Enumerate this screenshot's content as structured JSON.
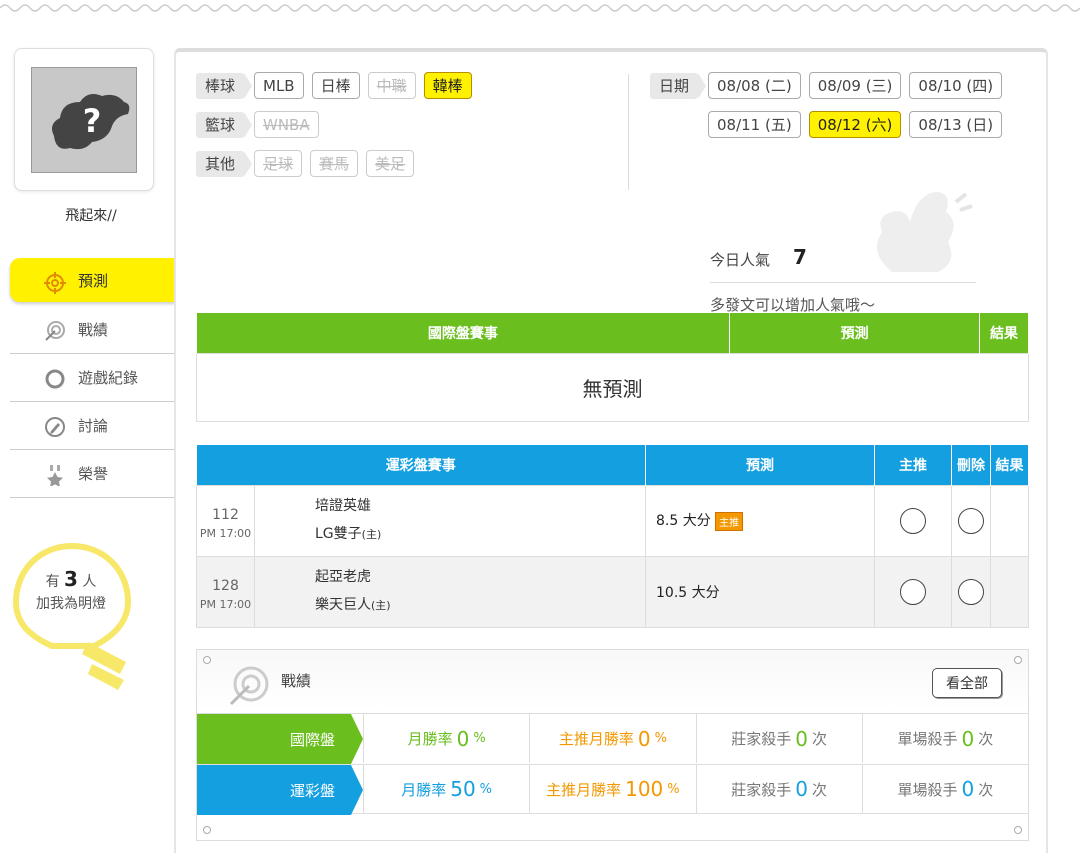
{
  "profile": {
    "username": "飛起來//"
  },
  "nav": {
    "items": [
      {
        "label": "預測",
        "icon": "target-icon",
        "active": true
      },
      {
        "label": "戰績",
        "icon": "record-target-icon"
      },
      {
        "label": "遊戲紀錄",
        "icon": "ring-icon"
      },
      {
        "label": "討論",
        "icon": "discussion-icon"
      },
      {
        "label": "榮譽",
        "icon": "medal-icon"
      }
    ]
  },
  "lamp": {
    "prefix": "有",
    "count": "3",
    "suffix": "人",
    "line2": "加我為明燈"
  },
  "filters": {
    "baseball": {
      "label": "棒球",
      "chips": [
        "MLB",
        "日棒",
        "中職",
        "韓棒"
      ]
    },
    "basketball": {
      "label": "籃球",
      "chips": [
        "WNBA"
      ]
    },
    "other": {
      "label": "其他",
      "chips": [
        "足球",
        "賽馬",
        "美足"
      ]
    }
  },
  "dates": {
    "label": "日期",
    "row1": [
      "08/08 (二)",
      "08/09 (三)",
      "08/10 (四)"
    ],
    "row2": [
      "08/11 (五)",
      "08/12 (六)",
      "08/13 (日)"
    ]
  },
  "popularity": {
    "label": "今日人氣",
    "value": "7",
    "hint": "多發文可以增加人氣哦～"
  },
  "intl_table": {
    "headers": [
      "國際盤賽事",
      "預測",
      "結果"
    ],
    "empty": "無預測"
  },
  "sports_table": {
    "headers": [
      "運彩盤賽事",
      "預測",
      "主推",
      "刪除",
      "結果"
    ],
    "rows": [
      {
        "num": "112",
        "time": "PM 17:00",
        "team1": "培證英雄",
        "team2": "LG雙子",
        "home": "(主)",
        "pred": "8.5 大分",
        "tag": "主推"
      },
      {
        "num": "128",
        "time": "PM 17:00",
        "team1": "起亞老虎",
        "team2": "樂天巨人",
        "home": "(主)",
        "pred": "10.5 大分",
        "tag": ""
      }
    ]
  },
  "stats": {
    "title": "戰績",
    "view_all": "看全部",
    "rows": [
      {
        "label": "國際盤",
        "c1": "月勝率",
        "v1": "0",
        "u1": "%",
        "c2": "主推月勝率",
        "v2": "0",
        "u2": "%",
        "c3": "莊家殺手",
        "v3": "0",
        "u3": "次",
        "c4": "單場殺手",
        "v4": "0",
        "u4": "次"
      },
      {
        "label": "運彩盤",
        "c1": "月勝率",
        "v1": "50",
        "u1": "%",
        "c2": "主推月勝率",
        "v2": "100",
        "u2": "%",
        "c3": "莊家殺手",
        "v3": "0",
        "u3": "次",
        "c4": "單場殺手",
        "v4": "0",
        "u4": "次"
      }
    ]
  },
  "colors": {
    "green": "#6abe1e",
    "blue": "#14a0e0",
    "yellow": "#fff100",
    "orange": "#f39800"
  }
}
